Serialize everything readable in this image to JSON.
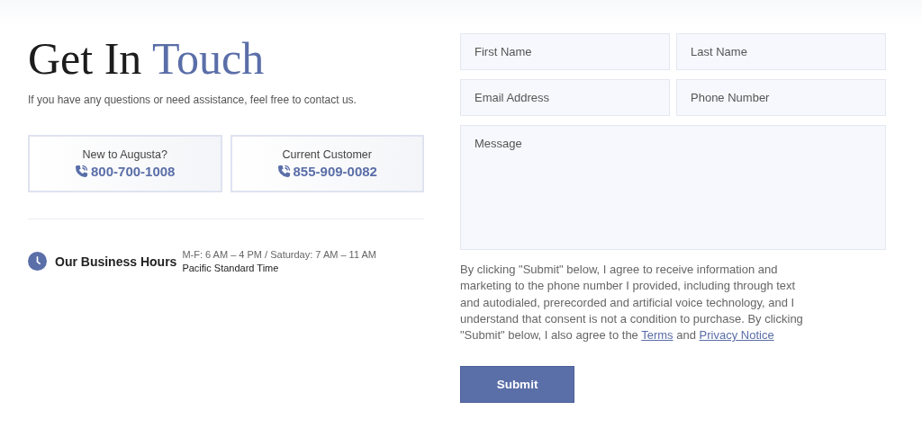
{
  "heading": {
    "text": "Get In",
    "accent": "Touch"
  },
  "subtitle": "If you have any questions or need assistance, feel free to contact us.",
  "phone_cards": [
    {
      "label": "New to Augusta?",
      "number": "800-700-1008"
    },
    {
      "label": "Current Customer",
      "number": "855-909-0082"
    }
  ],
  "business_hours": {
    "title": "Our Business Hours",
    "schedule": "M-F: 6 AM – 4 PM / Saturday: 7 AM – 11 AM",
    "timezone": "Pacific Standard Time"
  },
  "form": {
    "fields": [
      {
        "kind": "input",
        "placeholder": "First Name"
      },
      {
        "kind": "input",
        "placeholder": "Last Name"
      },
      {
        "kind": "input",
        "placeholder": "Email Address"
      },
      {
        "kind": "input",
        "placeholder": "Phone Number"
      },
      {
        "kind": "textarea",
        "placeholder": "Message"
      }
    ],
    "consent": [
      {
        "kind": "text",
        "text": "By clicking \"Submit\" below, I agree to receive information and marketing to the phone number I provided, including through text and autodialed, prerecorded and artificial voice technology, and I understand that consent is not a condition to purchase. By clicking \"Submit\" below, I also agree to the "
      },
      {
        "kind": "link",
        "text": "Terms"
      },
      {
        "kind": "text",
        "text": " and "
      },
      {
        "kind": "link",
        "text": "Privacy Notice"
      }
    ],
    "submit": "Submit"
  }
}
